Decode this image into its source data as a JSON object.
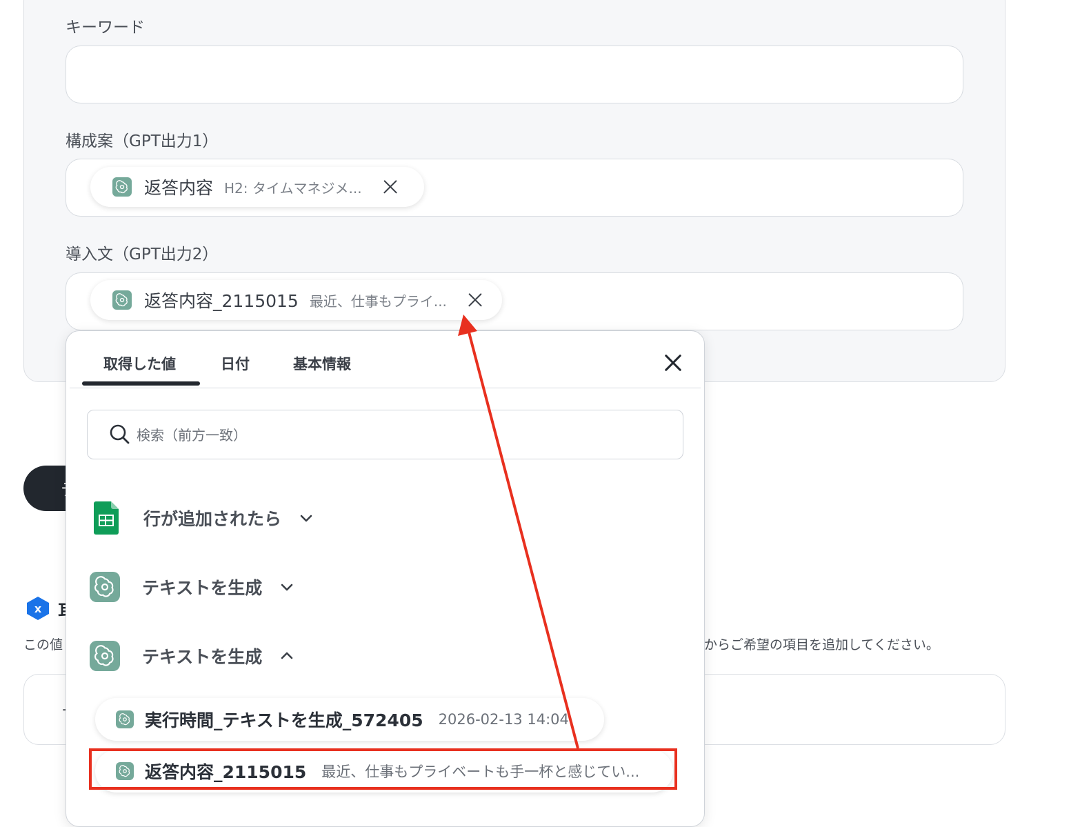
{
  "form": {
    "keyword_label": "キーワード",
    "keyword_value": "",
    "outline_label": "構成案（GPT出力1）",
    "outline_chip": {
      "title": "返答内容",
      "preview": "H2: タイムマネジメ..."
    },
    "intro_label": "導入文（GPT出力2）",
    "intro_chip": {
      "title": "返答内容_2115015",
      "preview": "最近、仕事もプライ..."
    }
  },
  "background": {
    "dark_button_text": "テ",
    "section_title_char": "耳",
    "desc_left": "この値",
    "desc_right": "からご希望の項目を追加してください。",
    "bottom_card_text": "－"
  },
  "popup": {
    "tabs": [
      {
        "label": "取得した値",
        "active": true
      },
      {
        "label": "日付",
        "active": false
      },
      {
        "label": "基本情報",
        "active": false
      }
    ],
    "search_placeholder": "検索（前方一致）",
    "groups": [
      {
        "label": "行が追加されたら",
        "icon": "google-sheets-icon",
        "expanded": false
      },
      {
        "label": "テキストを生成",
        "icon": "chatgpt-icon",
        "expanded": false
      },
      {
        "label": "テキストを生成",
        "icon": "chatgpt-icon",
        "expanded": true
      }
    ],
    "items": [
      {
        "title": "実行時間_テキストを生成_572405",
        "value": "2026-02-13 14:04"
      },
      {
        "title": "返答内容_2115015",
        "value": "最近、仕事もプライベートも手一杯と感じてい..."
      }
    ]
  },
  "annotation": {
    "color": "#e8301f"
  },
  "colors": {
    "chatgpt": "#75a99a",
    "sheets": "#0f9d58",
    "dark": "#22272e",
    "xicon": "#1a73e8"
  }
}
